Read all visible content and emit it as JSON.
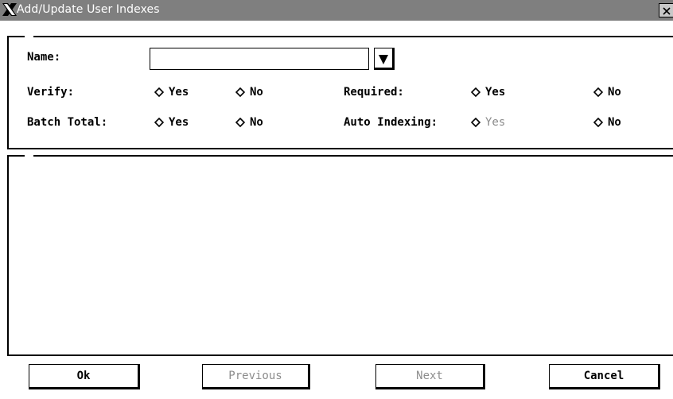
{
  "window": {
    "title": "Add/Update User Indexes",
    "close_glyph": "×"
  },
  "form": {
    "name_label": "Name:",
    "name_value": "",
    "verify_label": "Verify:",
    "required_label": "Required:",
    "batch_total_label": "Batch Total:",
    "auto_indexing_label": "Auto Indexing:",
    "yes_label": "Yes",
    "no_label": "No"
  },
  "buttons": {
    "ok": "Ok",
    "previous": "Previous",
    "next": "Next",
    "cancel": "Cancel"
  }
}
